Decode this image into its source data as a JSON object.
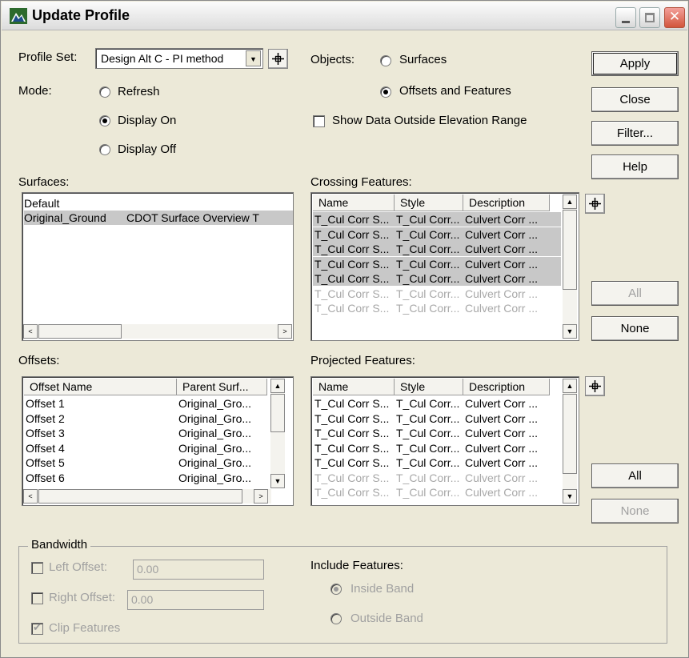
{
  "window": {
    "title": "Update Profile"
  },
  "profile_set": {
    "label": "Profile Set:",
    "value": "Design Alt C - PI method"
  },
  "mode": {
    "label": "Mode:",
    "options": [
      {
        "label": "Refresh",
        "selected": false
      },
      {
        "label": "Display On",
        "selected": true
      },
      {
        "label": "Display Off",
        "selected": false
      }
    ]
  },
  "objects": {
    "label": "Objects:",
    "options": [
      {
        "label": "Surfaces",
        "selected": false
      },
      {
        "label": "Offsets and Features",
        "selected": true
      }
    ]
  },
  "show_data_outside": {
    "label": "Show Data Outside Elevation Range",
    "checked": false
  },
  "buttons": {
    "apply": "Apply",
    "close": "Close",
    "filter": "Filter...",
    "help": "Help"
  },
  "surfaces": {
    "label": "Surfaces:",
    "rows": [
      {
        "name": "Default",
        "desc": ""
      },
      {
        "name": "Original_Ground",
        "desc": "CDOT Surface Overview T"
      }
    ],
    "scroll_left_glyph": "<",
    "scroll_right_glyph": ">"
  },
  "crossing": {
    "label": "Crossing Features:",
    "headers": [
      "Name",
      "Style",
      "Description"
    ],
    "rows": [
      [
        "T_Cul Corr S...",
        "T_Cul Corr...",
        "Culvert Corr ..."
      ],
      [
        "T_Cul Corr S...",
        "T_Cul Corr...",
        "Culvert Corr ..."
      ],
      [
        "T_Cul Corr S...",
        "T_Cul Corr...",
        "Culvert Corr ..."
      ],
      [
        "T_Cul Corr S...",
        "T_Cul Corr...",
        "Culvert Corr ..."
      ],
      [
        "T_Cul Corr S...",
        "T_Cul Corr...",
        "Culvert Corr ..."
      ],
      [
        "T_Cul Corr S...",
        "T_Cul Corr...",
        "Culvert Corr ..."
      ],
      [
        "T_Cul Corr S...",
        "T_Cul Corr...",
        "Culvert Corr ..."
      ]
    ],
    "all": "All",
    "none": "None"
  },
  "offsets": {
    "label": "Offsets:",
    "headers": [
      "Offset Name",
      "Parent Surf..."
    ],
    "rows": [
      [
        "Offset 1",
        "Original_Gro..."
      ],
      [
        "Offset 2",
        "Original_Gro..."
      ],
      [
        "Offset 3",
        "Original_Gro..."
      ],
      [
        "Offset 4",
        "Original_Gro..."
      ],
      [
        "Offset 5",
        "Original_Gro..."
      ],
      [
        "Offset 6",
        "Original_Gro..."
      ]
    ]
  },
  "projected": {
    "label": "Projected Features:",
    "headers": [
      "Name",
      "Style",
      "Description"
    ],
    "rows": [
      [
        "T_Cul Corr S...",
        "T_Cul Corr...",
        "Culvert Corr ..."
      ],
      [
        "T_Cul Corr S...",
        "T_Cul Corr...",
        "Culvert Corr ..."
      ],
      [
        "T_Cul Corr S...",
        "T_Cul Corr...",
        "Culvert Corr ..."
      ],
      [
        "T_Cul Corr S...",
        "T_Cul Corr...",
        "Culvert Corr ..."
      ],
      [
        "T_Cul Corr S...",
        "T_Cul Corr...",
        "Culvert Corr ..."
      ],
      [
        "T_Cul Corr S...",
        "T_Cul Corr...",
        "Culvert Corr ..."
      ],
      [
        "T_Cul Corr S...",
        "T_Cul Corr...",
        "Culvert Corr ..."
      ]
    ],
    "all": "All",
    "none": "None"
  },
  "bandwidth": {
    "label": "Bandwidth",
    "left_offset_label": "Left Offset:",
    "left_offset_value": "0.00",
    "right_offset_label": "Right Offset:",
    "right_offset_value": "0.00",
    "clip_label": "Clip Features",
    "include_label": "Include Features:",
    "inside": "Inside Band",
    "outside": "Outside Band"
  }
}
